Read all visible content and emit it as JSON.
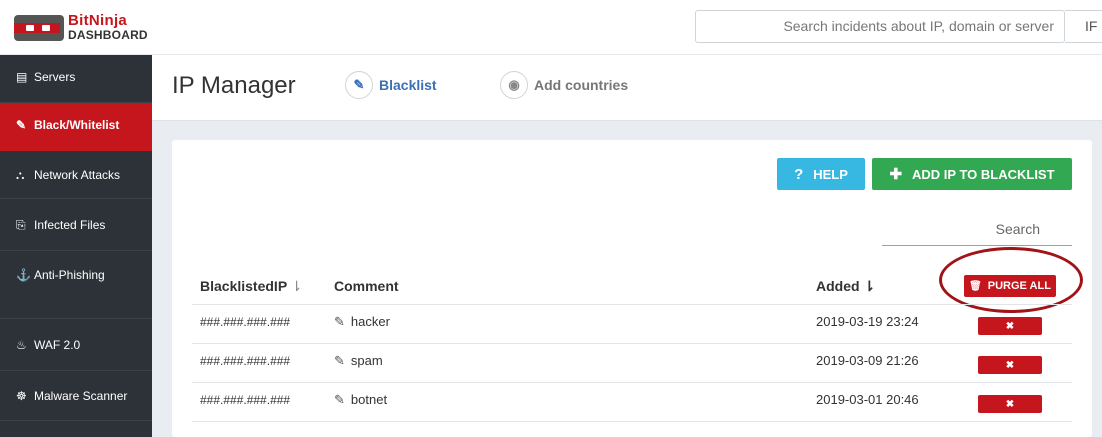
{
  "brand": {
    "line1": "BitNinja",
    "line2": "DASHBOARD"
  },
  "top_search": {
    "placeholder": "Search incidents about IP, domain or server",
    "extra": "IF"
  },
  "sidebar": {
    "items": [
      {
        "label": "Servers",
        "icon": "server-icon",
        "glyph": "▤"
      },
      {
        "label": "Black/Whitelist",
        "icon": "wrench-icon",
        "glyph": "✎"
      },
      {
        "label": "Network Attacks",
        "icon": "sitemap-icon",
        "glyph": "⛬"
      },
      {
        "label": "Infected Files",
        "icon": "files-icon",
        "glyph": "⎘"
      },
      {
        "label": "Anti-Phishing",
        "icon": "anchor-icon",
        "glyph": "⚓"
      },
      {
        "label": "WAF 2.0",
        "icon": "fire-icon",
        "glyph": "♨"
      },
      {
        "label": "Malware Scanner",
        "icon": "bug-icon",
        "glyph": "☸"
      }
    ]
  },
  "header": {
    "title": "IP Manager",
    "tabs": [
      {
        "label": "Blacklist",
        "icon": "wrench-icon",
        "glyph": "✎"
      },
      {
        "label": "Add countries",
        "icon": "globe-icon",
        "glyph": "◉"
      }
    ]
  },
  "toolbar": {
    "help_label": "HELP",
    "add_label": "ADD IP TO BLACKLIST",
    "search_placeholder": "Search"
  },
  "table": {
    "headers": {
      "ip": "BlacklistedIP",
      "comment": "Comment",
      "added": "Added"
    },
    "purge_label": "PURGE ALL",
    "rows": [
      {
        "ip": "###.###.###.###",
        "comment": "hacker",
        "added": "2019-03-19 23:24"
      },
      {
        "ip": "###.###.###.###",
        "comment": "spam",
        "added": "2019-03-09 21:26"
      },
      {
        "ip": "###.###.###.###",
        "comment": "botnet",
        "added": "2019-03-01 20:46"
      }
    ]
  },
  "colors": {
    "brand_red": "#c4161c",
    "help_blue": "#36b8e2",
    "add_green": "#32a852",
    "sidebar": "#2d3238"
  }
}
